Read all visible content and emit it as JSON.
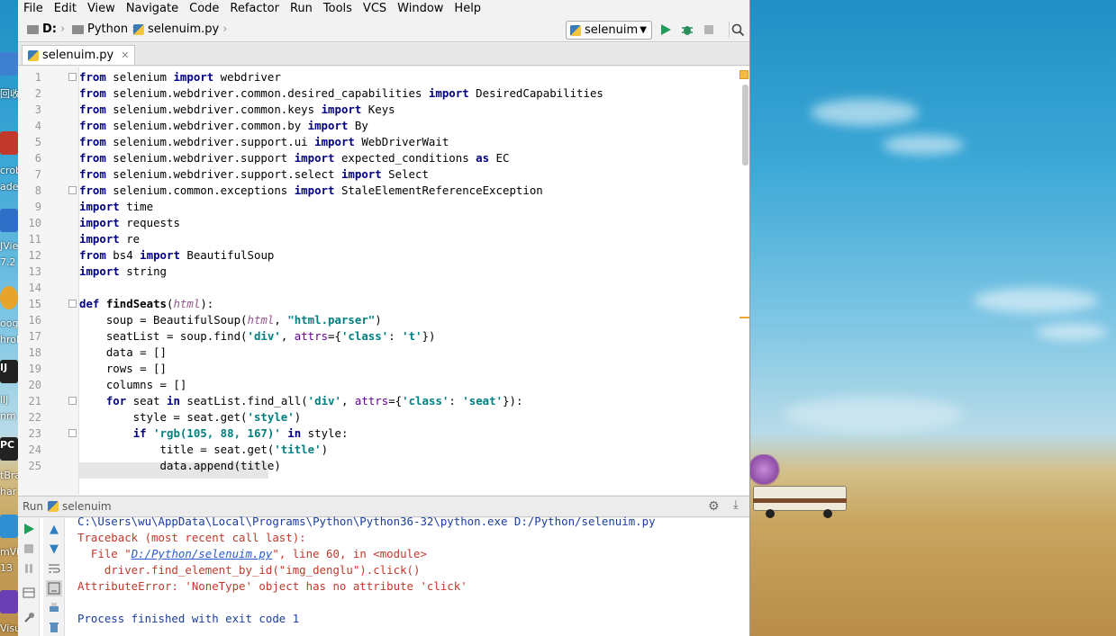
{
  "menu": [
    "File",
    "Edit",
    "View",
    "Navigate",
    "Code",
    "Refactor",
    "Run",
    "Tools",
    "VCS",
    "Window",
    "Help"
  ],
  "breadcrumb": {
    "drive": "D:",
    "folder": "Python",
    "file": "selenuim.py"
  },
  "toolbar": {
    "run_config": "selenuim",
    "run_icon": "play-icon",
    "debug_icon": "bug-icon",
    "stop_icon": "stop-icon",
    "search_icon": "search-icon"
  },
  "tab": {
    "label": "selenuim.py"
  },
  "editor": {
    "line_numbers": [
      "1",
      "2",
      "3",
      "4",
      "5",
      "6",
      "7",
      "8",
      "9",
      "10",
      "11",
      "12",
      "13",
      "14",
      "15",
      "16",
      "17",
      "18",
      "19",
      "20",
      "21",
      "22",
      "23",
      "24",
      "25"
    ],
    "lines": [
      "from selenium import webdriver",
      "from selenium.webdriver.common.desired_capabilities import DesiredCapabilities",
      "from selenium.webdriver.common.keys import Keys",
      "from selenium.webdriver.common.by import By",
      "from selenium.webdriver.support.ui import WebDriverWait",
      "from selenium.webdriver.support import expected_conditions as EC",
      "from selenium.webdriver.support.select import Select",
      "from selenium.common.exceptions import StaleElementReferenceException",
      "import time",
      "import requests",
      "import re",
      "from bs4 import BeautifulSoup",
      "import string",
      "",
      "def findSeats(html):",
      "    soup = BeautifulSoup(html, \"html.parser\")",
      "    seatList = soup.find('div', attrs={'class': 't'})",
      "    data = []",
      "    rows = []",
      "    columns = []",
      "    for seat in seatList.find_all('div', attrs={'class': 'seat'}):",
      "        style = seat.get('style')",
      "        if 'rgb(105, 88, 167)' in style:",
      "            title = seat.get('title')",
      "            data.append(title)"
    ]
  },
  "run_panel": {
    "tab_label": "Run",
    "config_label": "selenuim",
    "console": [
      "C:\\Users\\wu\\AppData\\Local\\Programs\\Python\\Python36-32\\python.exe D:/Python/selenuim.py",
      "Traceback (most recent call last):",
      "  File \"D:/Python/selenuim.py\", line 60, in <module>",
      "    driver.find_element_by_id(\"img_denglu\").click()",
      "AttributeError: 'NoneType' object has no attribute 'click'",
      "",
      "Process finished with exit code 1"
    ]
  },
  "desktop_icons": [
    "回收",
    "crob",
    "ade",
    "JVie",
    "7.2",
    "oog",
    "hrol",
    "IJ",
    "llJ",
    "nm",
    "PC",
    "tBra",
    "har",
    "mVi",
    "13",
    "Visu"
  ],
  "colors": {
    "keyword": "#000080",
    "string": "#008080",
    "error": "#c0392b",
    "accent": "#f0a732"
  }
}
